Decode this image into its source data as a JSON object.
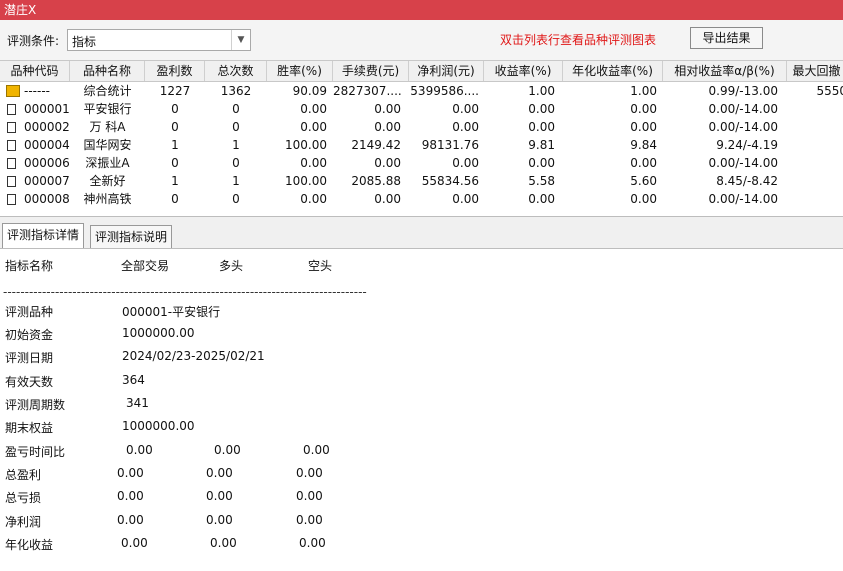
{
  "window": {
    "title": "潜庄X"
  },
  "toolbar": {
    "condition_label": "评测条件:",
    "condition_value": "指标",
    "hint": "双击列表行查看品种评测图表",
    "export_label": "导出结果"
  },
  "table": {
    "columns": [
      "品种代码",
      "品种名称",
      "盈利数",
      "总次数",
      "胜率(%)",
      "手续费(元)",
      "净利润(元)",
      "收益率(%)",
      "年化收益率(%)",
      "相对收益率α/β(%)",
      "最大回撤"
    ],
    "rows": [
      [
        "------",
        "综合统计",
        "1227",
        "1362",
        "90.09",
        "2827307....",
        "5399586....",
        "1.00",
        "1.00",
        "0.99/-13.00",
        "5550"
      ],
      [
        "000001",
        "平安银行",
        "0",
        "0",
        "0.00",
        "0.00",
        "0.00",
        "0.00",
        "0.00",
        "0.00/-14.00",
        ""
      ],
      [
        "000002",
        "万 科A",
        "0",
        "0",
        "0.00",
        "0.00",
        "0.00",
        "0.00",
        "0.00",
        "0.00/-14.00",
        ""
      ],
      [
        "000004",
        "国华网安",
        "1",
        "1",
        "100.00",
        "2149.42",
        "98131.76",
        "9.81",
        "9.84",
        "9.24/-4.19",
        ""
      ],
      [
        "000006",
        "深振业A",
        "0",
        "0",
        "0.00",
        "0.00",
        "0.00",
        "0.00",
        "0.00",
        "0.00/-14.00",
        ""
      ],
      [
        "000007",
        "全新好",
        "1",
        "1",
        "100.00",
        "2085.88",
        "55834.56",
        "5.58",
        "5.60",
        "8.45/-8.42",
        ""
      ],
      [
        "000008",
        "神州高铁",
        "0",
        "0",
        "0.00",
        "0.00",
        "0.00",
        "0.00",
        "0.00",
        "0.00/-14.00",
        ""
      ]
    ]
  },
  "tabs": [
    "评测指标详情",
    "评测指标说明"
  ],
  "detail": {
    "headers": [
      "指标名称",
      "全部交易",
      "多头",
      "空头"
    ],
    "separator": "------------------------------------------------------------------------------------",
    "info": [
      {
        "label": "评测品种",
        "value": "000001-平安银行"
      },
      {
        "label": "初始资金",
        "value": "1000000.00"
      },
      {
        "label": "评测日期",
        "value": "2024/02/23-2025/02/21"
      },
      {
        "label": "有效天数",
        "value": "364"
      },
      {
        "label": "评测周期数",
        "value": "341"
      },
      {
        "label": "期末权益",
        "value": "1000000.00"
      }
    ],
    "metrics": [
      {
        "label": "盈亏时间比",
        "all": "0.00",
        "long": "0.00",
        "short": "0.00"
      },
      {
        "label": "总盈利",
        "all": "0.00",
        "long": "0.00",
        "short": "0.00"
      },
      {
        "label": "总亏损",
        "all": "0.00",
        "long": "0.00",
        "short": "0.00"
      },
      {
        "label": "净利润",
        "all": "0.00",
        "long": "0.00",
        "short": "0.00"
      },
      {
        "label": "年化收益",
        "all": "0.00",
        "long": "0.00",
        "short": "0.00"
      }
    ]
  }
}
